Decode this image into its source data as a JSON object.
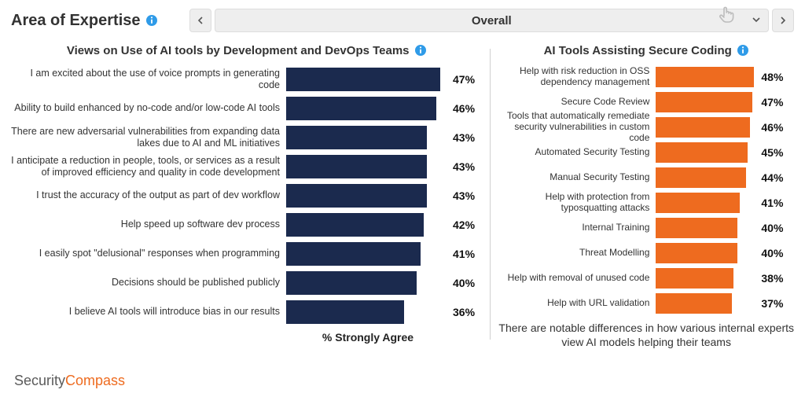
{
  "header": {
    "title": "Area of Expertise",
    "selector_label": "Overall"
  },
  "left_chart": {
    "title": "Views on Use of AI tools by Development and DevOps Teams",
    "xunit": "% Strongly Agree",
    "items": [
      {
        "label": "I am excited about the use of voice prompts in generating code",
        "value": 47
      },
      {
        "label": "Ability to build enhanced by no-code and/or low-code AI tools",
        "value": 46
      },
      {
        "label": "There are new adversarial vulnerabilities from expanding data lakes due to AI and ML initiatives",
        "value": 43
      },
      {
        "label": "I anticipate a reduction in people, tools, or services as a result of improved efficiency and quality in code development",
        "value": 43
      },
      {
        "label": "I trust the accuracy of the output as part of dev workflow",
        "value": 43
      },
      {
        "label": "Help speed up software dev process",
        "value": 42
      },
      {
        "label": "I easily spot \"delusional\" responses when programming",
        "value": 41
      },
      {
        "label": "Decisions should be published publicly",
        "value": 40
      },
      {
        "label": "I believe AI tools will introduce bias in our results",
        "value": 36
      }
    ]
  },
  "right_chart": {
    "title": "AI Tools Assisting Secure Coding",
    "caption": "There are notable differences in how various internal experts view AI models helping their teams",
    "items": [
      {
        "label": "Help with risk reduction in OSS dependency management",
        "value": 48
      },
      {
        "label": "Secure Code Review",
        "value": 47
      },
      {
        "label": "Tools that automatically remediate security vulnerabilities in custom code",
        "value": 46
      },
      {
        "label": "Automated Security Testing",
        "value": 45
      },
      {
        "label": "Manual Security Testing",
        "value": 44
      },
      {
        "label": "Help with protection from typosquatting attacks",
        "value": 41
      },
      {
        "label": "Internal Training",
        "value": 40
      },
      {
        "label": "Threat Modelling",
        "value": 40
      },
      {
        "label": "Help with removal of unused code",
        "value": 38
      },
      {
        "label": "Help with URL validation",
        "value": 37
      }
    ]
  },
  "brand": {
    "first": "Security",
    "second": "Compass"
  },
  "chart_data": [
    {
      "type": "bar",
      "orientation": "horizontal",
      "title": "Views on Use of AI tools by Development and DevOps Teams",
      "xlabel": "% Strongly Agree",
      "categories": [
        "I am excited about the use of voice prompts in generating code",
        "Ability to build enhanced by no-code and/or low-code AI tools",
        "There are new adversarial vulnerabilities from expanding data lakes due to AI and ML initiatives",
        "I anticipate a reduction in people, tools, or services as a result of improved efficiency and quality in code development",
        "I trust the accuracy of the output as part of dev workflow",
        "Help speed up software dev process",
        "I easily spot \"delusional\" responses when programming",
        "Decisions should be published publicly",
        "I believe AI tools will introduce bias in our results"
      ],
      "values": [
        47,
        46,
        43,
        43,
        43,
        42,
        41,
        40,
        36
      ],
      "xlim": [
        0,
        50
      ],
      "color": "#1b2a4e"
    },
    {
      "type": "bar",
      "orientation": "horizontal",
      "title": "AI Tools Assisting Secure Coding",
      "categories": [
        "Help with risk reduction in OSS dependency management",
        "Secure Code Review",
        "Tools that automatically remediate security vulnerabilities in custom code",
        "Automated Security Testing",
        "Manual Security Testing",
        "Help with protection from typosquatting attacks",
        "Internal Training",
        "Threat Modelling",
        "Help with removal of unused code",
        "Help with URL validation"
      ],
      "values": [
        48,
        47,
        46,
        45,
        44,
        41,
        40,
        40,
        38,
        37
      ],
      "xlim": [
        0,
        50
      ],
      "color": "#ee6b1f"
    }
  ]
}
